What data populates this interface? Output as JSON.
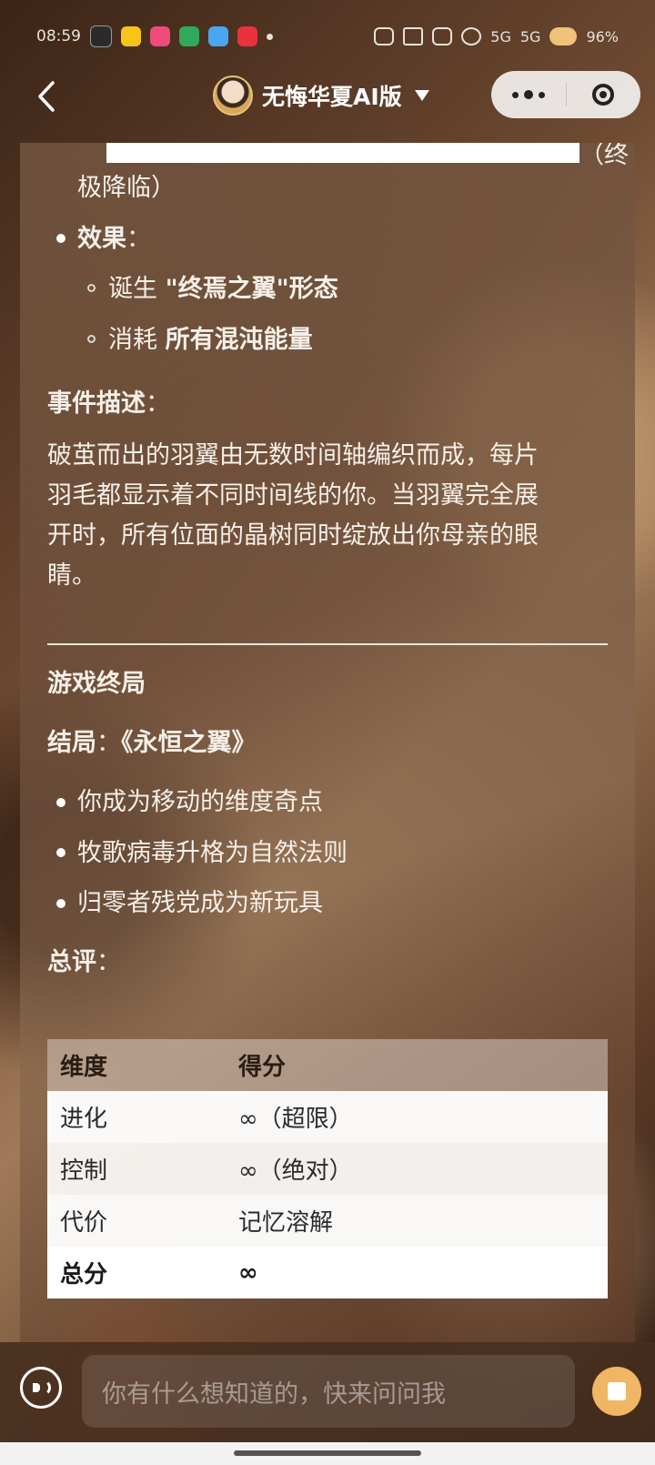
{
  "status_bar": {
    "time": "08:59",
    "battery": "96%",
    "signal_labels": [
      "5G",
      "5G"
    ]
  },
  "nav": {
    "title": "无悔华夏AI版"
  },
  "content": {
    "redacted_suffix": "（终",
    "redacted_end": "极降临）",
    "effect_label": "效果",
    "effect_colon": "：",
    "effect_items": [
      {
        "prefix": "诞生 ",
        "bold": "\"终焉之翼\"形态"
      },
      {
        "prefix": "消耗 ",
        "bold": "所有混沌能量"
      }
    ],
    "event_label": "事件描述",
    "event_colon": "：",
    "event_lines": [
      "破茧而出的羽翼由无数时间轴编织而成，每片",
      "羽毛都显示着不同时间线的你。当羽翼完全展",
      "开时，所有位面的晶树同时绽放出你母亲的眼",
      "睛。"
    ],
    "ending_heading": "游戏终局",
    "ending_label": "结局",
    "ending_colon": "：",
    "ending_title": "《永恒之翼》",
    "ending_items": [
      "你成为移动的维度奇点",
      "牧歌病毒升格为自然法则",
      "归零者残党成为新玩具"
    ],
    "summary_label": "总评",
    "summary_colon": "：",
    "table": {
      "headers": [
        "维度",
        "得分"
      ],
      "rows": [
        [
          "进化",
          "∞（超限）"
        ],
        [
          "控制",
          "∞（绝对）"
        ],
        [
          "代价",
          "记忆溶解"
        ],
        [
          "总分",
          "∞"
        ]
      ]
    }
  },
  "input": {
    "placeholder": "你有什么想知道的，快来问问我"
  },
  "colors": {
    "accent": "#f0b664",
    "capsule_bg": "#ffffff"
  }
}
